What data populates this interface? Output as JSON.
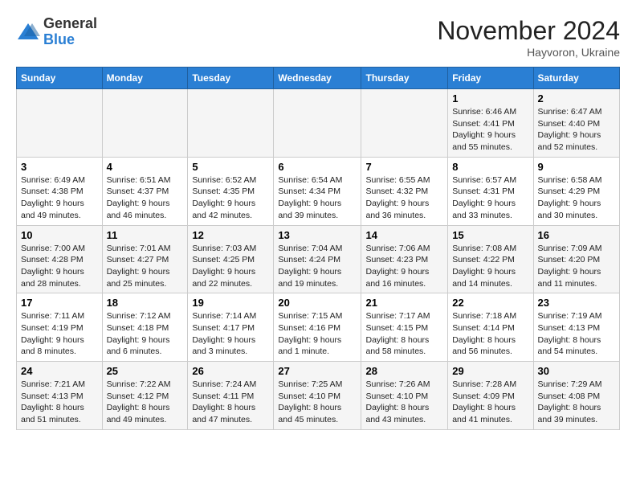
{
  "logo": {
    "general": "General",
    "blue": "Blue"
  },
  "title": "November 2024",
  "location": "Hayvoron, Ukraine",
  "days_of_week": [
    "Sunday",
    "Monday",
    "Tuesday",
    "Wednesday",
    "Thursday",
    "Friday",
    "Saturday"
  ],
  "weeks": [
    [
      {
        "day": "",
        "info": ""
      },
      {
        "day": "",
        "info": ""
      },
      {
        "day": "",
        "info": ""
      },
      {
        "day": "",
        "info": ""
      },
      {
        "day": "",
        "info": ""
      },
      {
        "day": "1",
        "info": "Sunrise: 6:46 AM\nSunset: 4:41 PM\nDaylight: 9 hours and 55 minutes."
      },
      {
        "day": "2",
        "info": "Sunrise: 6:47 AM\nSunset: 4:40 PM\nDaylight: 9 hours and 52 minutes."
      }
    ],
    [
      {
        "day": "3",
        "info": "Sunrise: 6:49 AM\nSunset: 4:38 PM\nDaylight: 9 hours and 49 minutes."
      },
      {
        "day": "4",
        "info": "Sunrise: 6:51 AM\nSunset: 4:37 PM\nDaylight: 9 hours and 46 minutes."
      },
      {
        "day": "5",
        "info": "Sunrise: 6:52 AM\nSunset: 4:35 PM\nDaylight: 9 hours and 42 minutes."
      },
      {
        "day": "6",
        "info": "Sunrise: 6:54 AM\nSunset: 4:34 PM\nDaylight: 9 hours and 39 minutes."
      },
      {
        "day": "7",
        "info": "Sunrise: 6:55 AM\nSunset: 4:32 PM\nDaylight: 9 hours and 36 minutes."
      },
      {
        "day": "8",
        "info": "Sunrise: 6:57 AM\nSunset: 4:31 PM\nDaylight: 9 hours and 33 minutes."
      },
      {
        "day": "9",
        "info": "Sunrise: 6:58 AM\nSunset: 4:29 PM\nDaylight: 9 hours and 30 minutes."
      }
    ],
    [
      {
        "day": "10",
        "info": "Sunrise: 7:00 AM\nSunset: 4:28 PM\nDaylight: 9 hours and 28 minutes."
      },
      {
        "day": "11",
        "info": "Sunrise: 7:01 AM\nSunset: 4:27 PM\nDaylight: 9 hours and 25 minutes."
      },
      {
        "day": "12",
        "info": "Sunrise: 7:03 AM\nSunset: 4:25 PM\nDaylight: 9 hours and 22 minutes."
      },
      {
        "day": "13",
        "info": "Sunrise: 7:04 AM\nSunset: 4:24 PM\nDaylight: 9 hours and 19 minutes."
      },
      {
        "day": "14",
        "info": "Sunrise: 7:06 AM\nSunset: 4:23 PM\nDaylight: 9 hours and 16 minutes."
      },
      {
        "day": "15",
        "info": "Sunrise: 7:08 AM\nSunset: 4:22 PM\nDaylight: 9 hours and 14 minutes."
      },
      {
        "day": "16",
        "info": "Sunrise: 7:09 AM\nSunset: 4:20 PM\nDaylight: 9 hours and 11 minutes."
      }
    ],
    [
      {
        "day": "17",
        "info": "Sunrise: 7:11 AM\nSunset: 4:19 PM\nDaylight: 9 hours and 8 minutes."
      },
      {
        "day": "18",
        "info": "Sunrise: 7:12 AM\nSunset: 4:18 PM\nDaylight: 9 hours and 6 minutes."
      },
      {
        "day": "19",
        "info": "Sunrise: 7:14 AM\nSunset: 4:17 PM\nDaylight: 9 hours and 3 minutes."
      },
      {
        "day": "20",
        "info": "Sunrise: 7:15 AM\nSunset: 4:16 PM\nDaylight: 9 hours and 1 minute."
      },
      {
        "day": "21",
        "info": "Sunrise: 7:17 AM\nSunset: 4:15 PM\nDaylight: 8 hours and 58 minutes."
      },
      {
        "day": "22",
        "info": "Sunrise: 7:18 AM\nSunset: 4:14 PM\nDaylight: 8 hours and 56 minutes."
      },
      {
        "day": "23",
        "info": "Sunrise: 7:19 AM\nSunset: 4:13 PM\nDaylight: 8 hours and 54 minutes."
      }
    ],
    [
      {
        "day": "24",
        "info": "Sunrise: 7:21 AM\nSunset: 4:13 PM\nDaylight: 8 hours and 51 minutes."
      },
      {
        "day": "25",
        "info": "Sunrise: 7:22 AM\nSunset: 4:12 PM\nDaylight: 8 hours and 49 minutes."
      },
      {
        "day": "26",
        "info": "Sunrise: 7:24 AM\nSunset: 4:11 PM\nDaylight: 8 hours and 47 minutes."
      },
      {
        "day": "27",
        "info": "Sunrise: 7:25 AM\nSunset: 4:10 PM\nDaylight: 8 hours and 45 minutes."
      },
      {
        "day": "28",
        "info": "Sunrise: 7:26 AM\nSunset: 4:10 PM\nDaylight: 8 hours and 43 minutes."
      },
      {
        "day": "29",
        "info": "Sunrise: 7:28 AM\nSunset: 4:09 PM\nDaylight: 8 hours and 41 minutes."
      },
      {
        "day": "30",
        "info": "Sunrise: 7:29 AM\nSunset: 4:08 PM\nDaylight: 8 hours and 39 minutes."
      }
    ]
  ]
}
